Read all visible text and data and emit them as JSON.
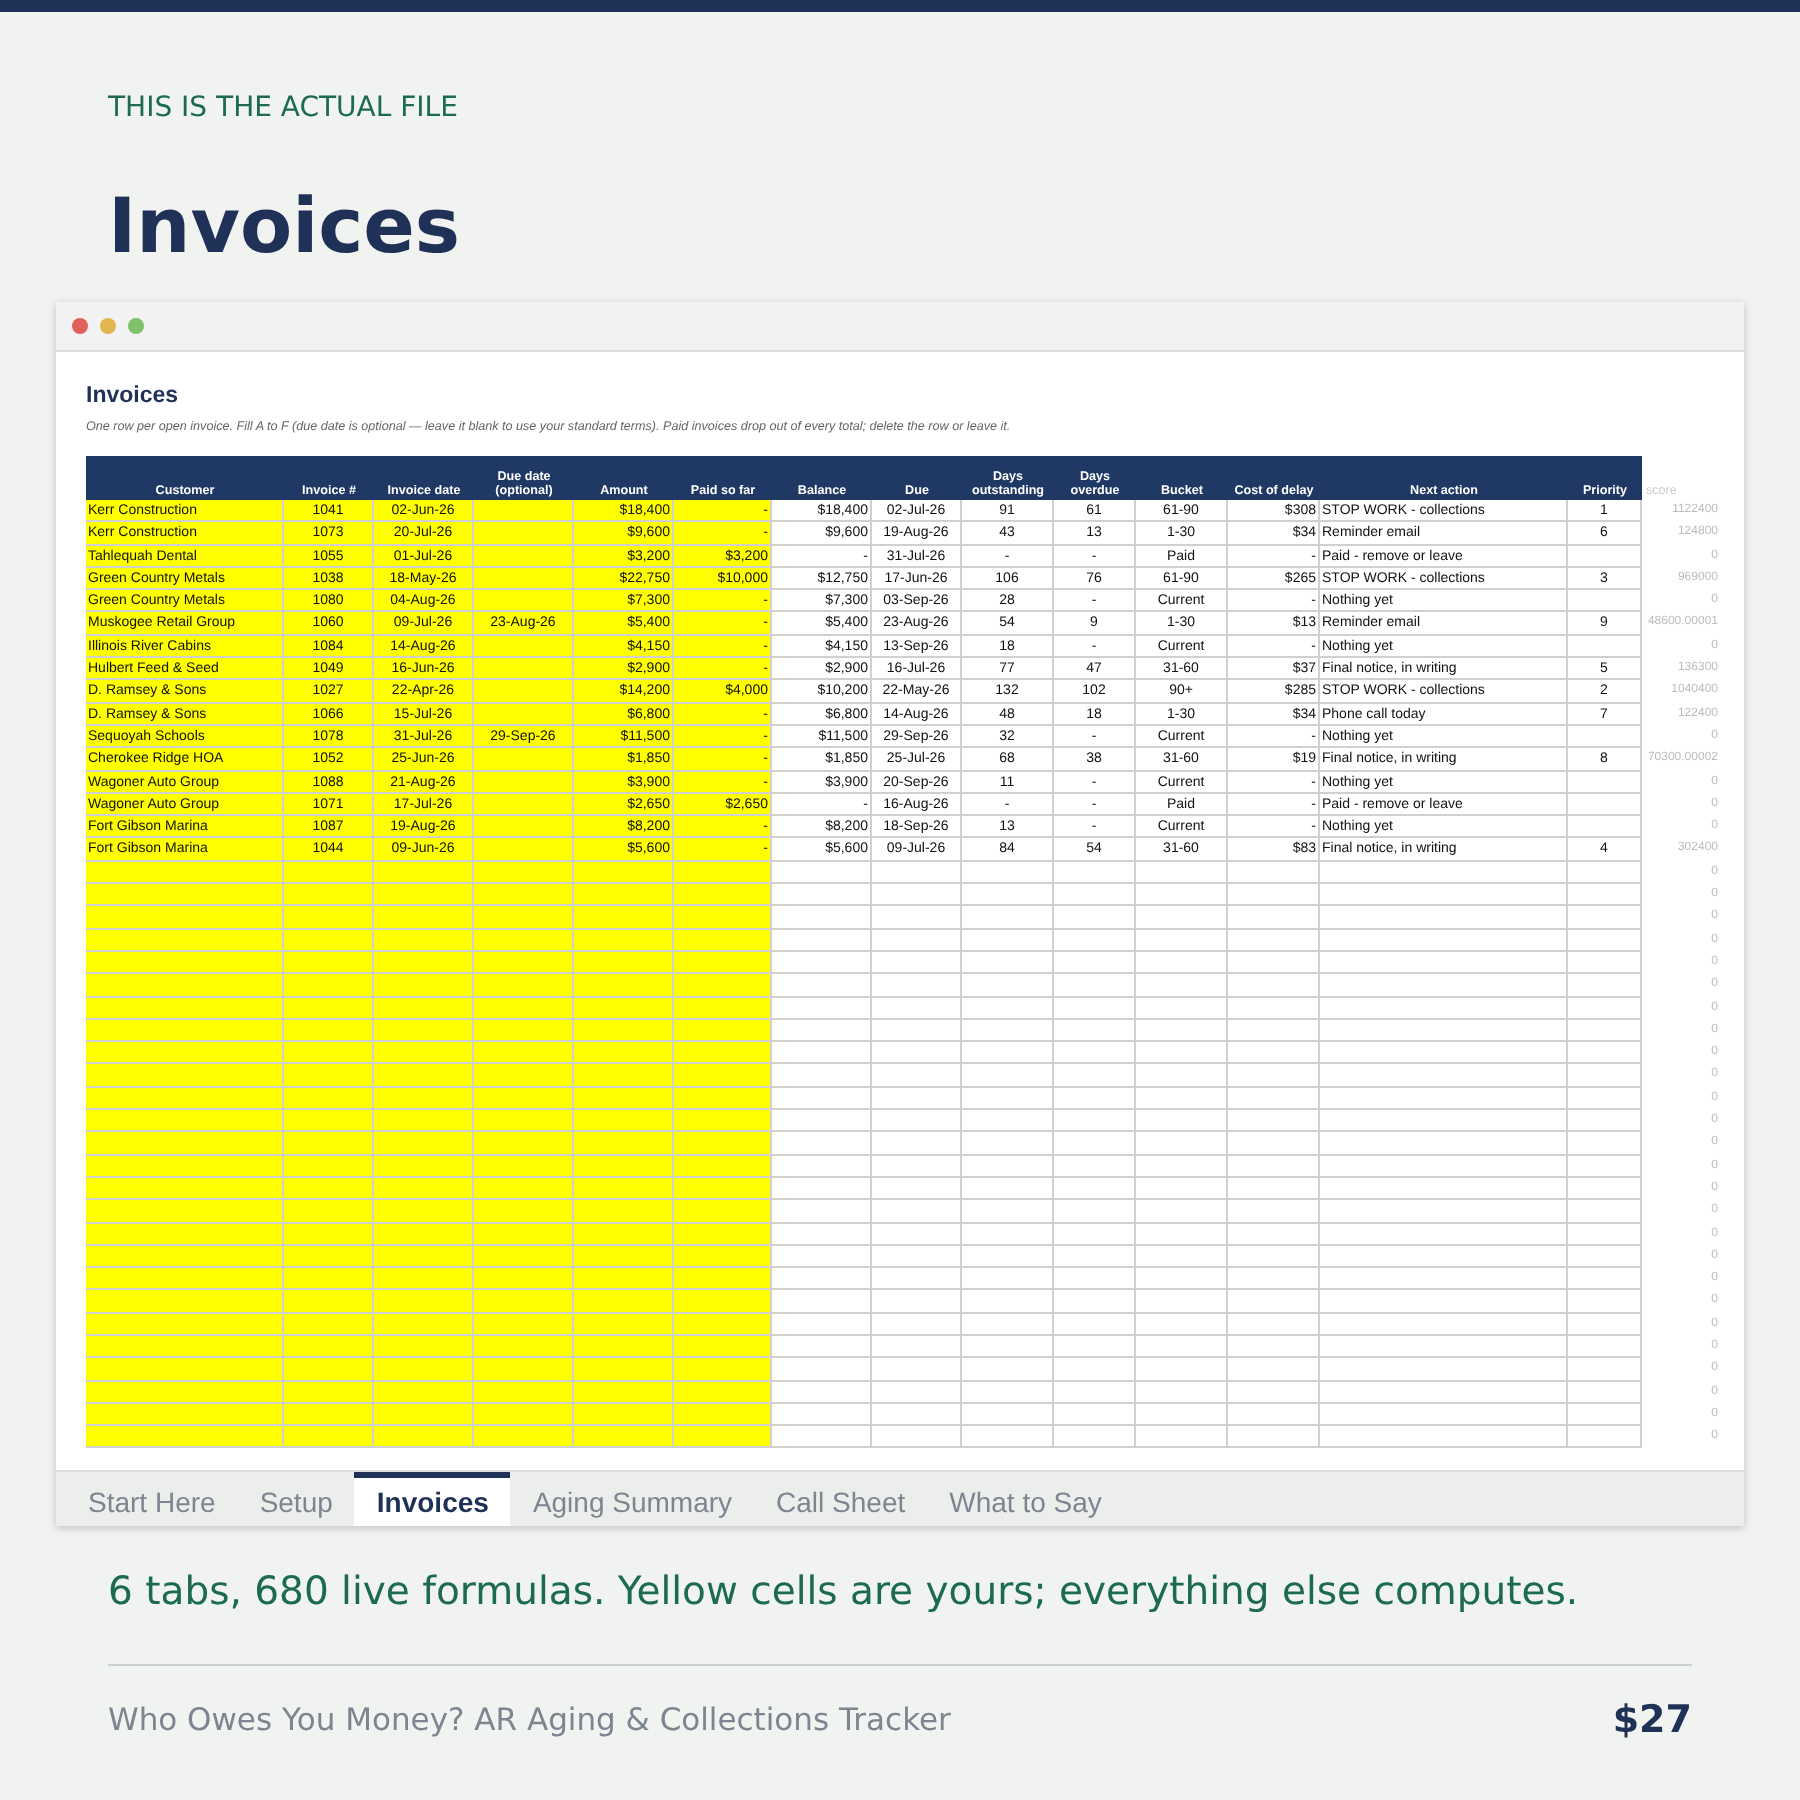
{
  "eyebrow": "THIS IS THE ACTUAL FILE",
  "heading": "Invoices",
  "sheet": {
    "title": "Invoices",
    "note": "One row per open invoice. Fill A to F (due date is optional — leave it blank to use your standard terms). Paid invoices drop out of every total; delete the row or leave it.",
    "columns": [
      {
        "label": "Customer"
      },
      {
        "label": "Invoice #"
      },
      {
        "label": "Invoice date"
      },
      {
        "label": "Due date (optional)"
      },
      {
        "label": "Amount"
      },
      {
        "label": "Paid so far"
      },
      {
        "label": "Balance"
      },
      {
        "label": "Due"
      },
      {
        "label": "Days outstanding"
      },
      {
        "label": "Days overdue"
      },
      {
        "label": "Bucket"
      },
      {
        "label": "Cost of delay"
      },
      {
        "label": "Next action"
      },
      {
        "label": "Priority"
      },
      {
        "label": "score"
      }
    ],
    "rows": [
      {
        "customer": "Kerr Construction",
        "invoice": "1041",
        "invoice_date": "02-Jun-26",
        "amount": "$18,400",
        "paid": "-",
        "balance": "$18,400",
        "due": "02-Jul-26",
        "days_outstanding": "91",
        "days_overdue": "61",
        "bucket": "61-90",
        "cost": "$308",
        "next_action": "STOP WORK - collections",
        "priority": "1",
        "score": "1122400"
      },
      {
        "customer": "Kerr Construction",
        "invoice": "1073",
        "invoice_date": "20-Jul-26",
        "amount": "$9,600",
        "paid": "-",
        "balance": "$9,600",
        "due": "19-Aug-26",
        "days_outstanding": "43",
        "days_overdue": "13",
        "bucket": "1-30",
        "cost": "$34",
        "next_action": "Reminder email",
        "priority": "6",
        "score": "124800"
      },
      {
        "customer": "Tahlequah Dental",
        "invoice": "1055",
        "invoice_date": "01-Jul-26",
        "amount": "$3,200",
        "paid": "$3,200",
        "balance": "-",
        "due": "31-Jul-26",
        "days_outstanding": "-",
        "days_overdue": "-",
        "bucket": "Paid",
        "cost": "-",
        "next_action": "Paid - remove or leave",
        "score": "0"
      },
      {
        "customer": "Green Country Metals",
        "invoice": "1038",
        "invoice_date": "18-May-26",
        "amount": "$22,750",
        "paid": "$10,000",
        "balance": "$12,750",
        "due": "17-Jun-26",
        "days_outstanding": "106",
        "days_overdue": "76",
        "bucket": "61-90",
        "cost": "$265",
        "next_action": "STOP WORK - collections",
        "priority": "3",
        "score": "969000"
      },
      {
        "customer": "Green Country Metals",
        "invoice": "1080",
        "invoice_date": "04-Aug-26",
        "amount": "$7,300",
        "paid": "-",
        "balance": "$7,300",
        "due": "03-Sep-26",
        "days_outstanding": "28",
        "days_overdue": "-",
        "bucket": "Current",
        "cost": "-",
        "next_action": "Nothing yet",
        "score": "0"
      },
      {
        "customer": "Muskogee Retail Group",
        "invoice": "1060",
        "invoice_date": "09-Jul-26",
        "due_date": "23-Aug-26",
        "amount": "$5,400",
        "paid": "-",
        "balance": "$5,400",
        "due": "23-Aug-26",
        "days_outstanding": "54",
        "days_overdue": "9",
        "bucket": "1-30",
        "cost": "$13",
        "next_action": "Reminder email",
        "priority": "9",
        "score": "48600.00001"
      },
      {
        "customer": "Illinois River Cabins",
        "invoice": "1084",
        "invoice_date": "14-Aug-26",
        "amount": "$4,150",
        "paid": "-",
        "balance": "$4,150",
        "due": "13-Sep-26",
        "days_outstanding": "18",
        "days_overdue": "-",
        "bucket": "Current",
        "cost": "-",
        "next_action": "Nothing yet",
        "score": "0"
      },
      {
        "customer": "Hulbert Feed & Seed",
        "invoice": "1049",
        "invoice_date": "16-Jun-26",
        "amount": "$2,900",
        "paid": "-",
        "balance": "$2,900",
        "due": "16-Jul-26",
        "days_outstanding": "77",
        "days_overdue": "47",
        "bucket": "31-60",
        "cost": "$37",
        "next_action": "Final notice, in writing",
        "priority": "5",
        "score": "136300"
      },
      {
        "customer": "D. Ramsey & Sons",
        "invoice": "1027",
        "invoice_date": "22-Apr-26",
        "amount": "$14,200",
        "paid": "$4,000",
        "balance": "$10,200",
        "due": "22-May-26",
        "days_outstanding": "132",
        "days_overdue": "102",
        "bucket": "90+",
        "cost": "$285",
        "next_action": "STOP WORK - collections",
        "priority": "2",
        "score": "1040400"
      },
      {
        "customer": "D. Ramsey & Sons",
        "invoice": "1066",
        "invoice_date": "15-Jul-26",
        "amount": "$6,800",
        "paid": "-",
        "balance": "$6,800",
        "due": "14-Aug-26",
        "days_outstanding": "48",
        "days_overdue": "18",
        "bucket": "1-30",
        "cost": "$34",
        "next_action": "Phone call today",
        "priority": "7",
        "score": "122400"
      },
      {
        "customer": "Sequoyah Schools",
        "invoice": "1078",
        "invoice_date": "31-Jul-26",
        "due_date": "29-Sep-26",
        "amount": "$11,500",
        "paid": "-",
        "balance": "$11,500",
        "due": "29-Sep-26",
        "days_outstanding": "32",
        "days_overdue": "-",
        "bucket": "Current",
        "cost": "-",
        "next_action": "Nothing yet",
        "score": "0"
      },
      {
        "customer": "Cherokee Ridge HOA",
        "invoice": "1052",
        "invoice_date": "25-Jun-26",
        "amount": "$1,850",
        "paid": "-",
        "balance": "$1,850",
        "due": "25-Jul-26",
        "days_outstanding": "68",
        "days_overdue": "38",
        "bucket": "31-60",
        "cost": "$19",
        "next_action": "Final notice, in writing",
        "priority": "8",
        "score": "70300.00002"
      },
      {
        "customer": "Wagoner Auto Group",
        "invoice": "1088",
        "invoice_date": "21-Aug-26",
        "amount": "$3,900",
        "paid": "-",
        "balance": "$3,900",
        "due": "20-Sep-26",
        "days_outstanding": "11",
        "days_overdue": "-",
        "bucket": "Current",
        "cost": "-",
        "next_action": "Nothing yet",
        "score": "0"
      },
      {
        "customer": "Wagoner Auto Group",
        "invoice": "1071",
        "invoice_date": "17-Jul-26",
        "amount": "$2,650",
        "paid": "$2,650",
        "balance": "-",
        "due": "16-Aug-26",
        "days_outstanding": "-",
        "days_overdue": "-",
        "bucket": "Paid",
        "cost": "-",
        "next_action": "Paid - remove or leave",
        "score": "0"
      },
      {
        "customer": "Fort Gibson Marina",
        "invoice": "1087",
        "invoice_date": "19-Aug-26",
        "amount": "$8,200",
        "paid": "-",
        "balance": "$8,200",
        "due": "18-Sep-26",
        "days_outstanding": "13",
        "days_overdue": "-",
        "bucket": "Current",
        "cost": "-",
        "next_action": "Nothing yet",
        "score": "0"
      },
      {
        "customer": "Fort Gibson Marina",
        "invoice": "1044",
        "invoice_date": "09-Jun-26",
        "amount": "$5,600",
        "paid": "-",
        "balance": "$5,600",
        "due": "09-Jul-26",
        "days_outstanding": "84",
        "days_overdue": "54",
        "bucket": "31-60",
        "cost": "$83",
        "next_action": "Final notice, in writing",
        "priority": "4",
        "score": "302400"
      },
      {
        "score": "0"
      },
      {
        "score": "0"
      },
      {
        "score": "0"
      },
      {
        "score": "0"
      },
      {
        "score": "0"
      },
      {
        "score": "0"
      },
      {
        "score": "0"
      },
      {
        "score": "0"
      },
      {
        "score": "0"
      },
      {
        "score": "0"
      },
      {
        "score": "0"
      },
      {
        "score": "0"
      },
      {
        "score": "0"
      },
      {
        "score": "0"
      },
      {
        "score": "0"
      },
      {
        "score": "0"
      },
      {
        "score": "0"
      },
      {
        "score": "0"
      },
      {
        "score": "0"
      },
      {
        "score": "0"
      },
      {
        "score": "0"
      },
      {
        "score": "0"
      },
      {
        "score": "0"
      },
      {
        "score": "0"
      },
      {
        "score": "0"
      },
      {
        "score": "0"
      }
    ]
  },
  "tabs": [
    {
      "label": "Start Here",
      "selected": false
    },
    {
      "label": "Setup",
      "selected": false
    },
    {
      "label": "Invoices",
      "selected": true
    },
    {
      "label": "Aging Summary",
      "selected": false
    },
    {
      "label": "Call Sheet",
      "selected": false
    },
    {
      "label": "What to Say",
      "selected": false
    }
  ],
  "caption": "6 tabs, 680 live formulas. Yellow cells are yours; everything else computes.",
  "footer": {
    "product": "Who Owes You Money? AR Aging & Collections Tracker",
    "price": "$27"
  }
}
